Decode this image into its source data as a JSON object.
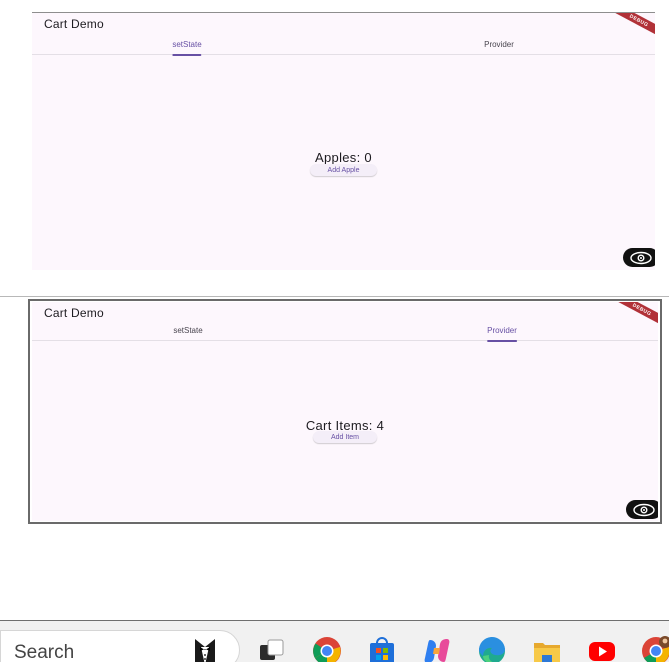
{
  "screens": [
    {
      "app_title": "Cart Demo",
      "tabs": [
        "setState",
        "Provider"
      ],
      "active_tab": 0,
      "counter_text": "Apples: 0",
      "button_label": "Add Apple",
      "debug_banner": "DEBUG"
    },
    {
      "app_title": "Cart Demo",
      "tabs": [
        "setState",
        "Provider"
      ],
      "active_tab": 1,
      "counter_text": "Cart Items: 4",
      "button_label": "Add Item",
      "debug_banner": "DEBUG"
    }
  ],
  "taskbar": {
    "search_placeholder": "Search",
    "apps": [
      "tuxedo-app-icon",
      "task-view-icon",
      "chrome-icon",
      "microsoft-store-icon",
      "copilot-icon",
      "edge-icon",
      "file-explorer-icon",
      "youtube-icon",
      "chrome-profile-icon"
    ]
  },
  "colors": {
    "app_background": "#fdf7fd",
    "accent": "#6750a4",
    "debug_banner": "#b13138",
    "taskbar": "#f1f1f1"
  }
}
